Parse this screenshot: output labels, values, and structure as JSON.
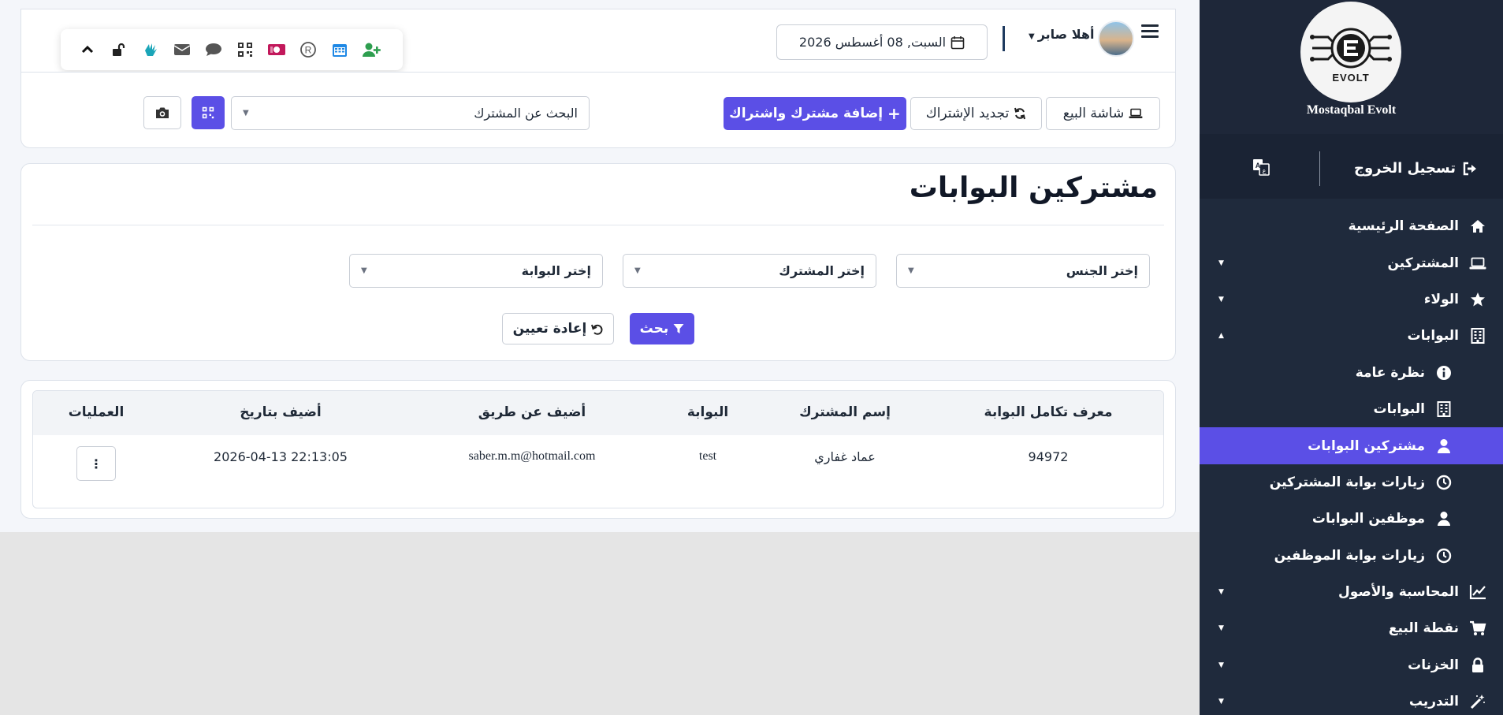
{
  "header": {
    "greeting": "أهلا صابر",
    "date": "السبت, 08 أغسطس 2026",
    "quick_icons": [
      "chevron-up-icon",
      "unlock-icon",
      "hand-icon",
      "envelope-icon",
      "comment-icon",
      "qrcode-icon",
      "money-bill-icon",
      "registered-icon",
      "calendar-icon",
      "user-plus-icon"
    ]
  },
  "actions": {
    "pos_screen": "شاشة البيع",
    "renew_subscription": "تجديد الإشتراك",
    "add_subscriber": "إضافة مشترك واشتراك",
    "search_subscriber_placeholder": "البحث عن المشترك"
  },
  "page": {
    "title": "مشتركين البوابات"
  },
  "filters": {
    "gender": "إختر الجنس",
    "subscriber": "إختر المشترك",
    "gate": "إختر البوابة",
    "search_button": "بحث",
    "reset_button": "إعادة تعيين"
  },
  "table": {
    "headers": {
      "gate_integration_id": "معرف تكامل البوابة",
      "subscriber_name": "إسم المشترك",
      "gate": "البوابة",
      "added_by": "أضيف عن طريق",
      "added_at": "أضيف بتاريخ",
      "operations": "العمليات"
    },
    "rows": [
      {
        "gate_integration_id": "94972",
        "subscriber_name": "عماد غفاري",
        "gate": "test",
        "added_by": "saber.m.m@hotmail.com",
        "added_at": "2026-04-13 22:13:05",
        "menu": "⋮"
      }
    ]
  },
  "sidebar": {
    "brand": "Mostaqbal Evolt",
    "logo_text": "EVOLT",
    "logout": "تسجيل الخروج",
    "items": [
      {
        "label": "الصفحة الرئيسية",
        "icon": "home-icon",
        "expandable": false
      },
      {
        "label": "المشتركين",
        "icon": "laptop-icon",
        "expandable": true
      },
      {
        "label": "الولاء",
        "icon": "star-icon",
        "expandable": true
      },
      {
        "label": "البوابات",
        "icon": "building-icon",
        "expandable": true,
        "expanded": true
      },
      {
        "label": "نظرة عامة",
        "icon": "info-icon",
        "sub": true
      },
      {
        "label": "البوابات",
        "icon": "building-icon",
        "sub": true
      },
      {
        "label": "مشتركين البوابات",
        "icon": "user-icon",
        "sub": true,
        "active": true
      },
      {
        "label": "زيارات بوابة المشتركين",
        "icon": "clock-icon",
        "sub": true
      },
      {
        "label": "موظفين البوابات",
        "icon": "user-icon",
        "sub": true
      },
      {
        "label": "زيارات بوابة الموظفين",
        "icon": "clock-icon",
        "sub": true
      },
      {
        "label": "المحاسبة والأصول",
        "icon": "chart-line-icon",
        "expandable": true
      },
      {
        "label": "نقطة البيع",
        "icon": "cart-icon",
        "expandable": true
      },
      {
        "label": "الخزنات",
        "icon": "lock-icon",
        "expandable": true
      },
      {
        "label": "التدريب",
        "icon": "magic-wand-icon",
        "expandable": true
      }
    ]
  },
  "colors": {
    "accent": "#5b4fe6",
    "sidebar_bg": "#1f2a3c",
    "sidebar_head_bg": "#1e2739",
    "page_bg": "#f4f6fa"
  }
}
